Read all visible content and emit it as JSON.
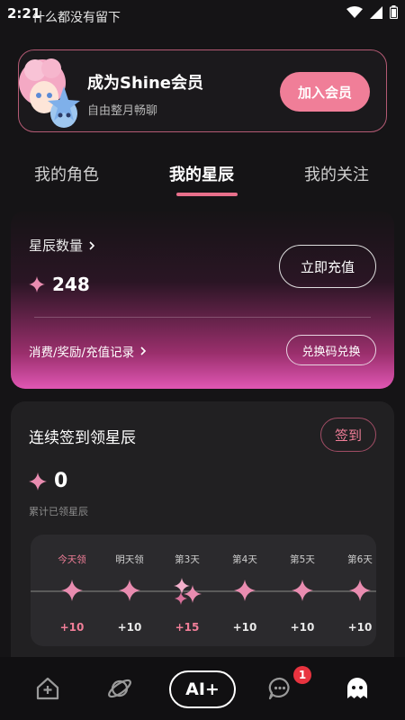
{
  "status_bar": {
    "time": "2:21",
    "toast": "什么都没有留下"
  },
  "vip_banner": {
    "title": "成为Shine会员",
    "subtitle": "自由整月畅聊",
    "join_label": "加入会员"
  },
  "tabs": [
    {
      "label": "我的角色",
      "active": false
    },
    {
      "label": "我的星辰",
      "active": true
    },
    {
      "label": "我的关注",
      "active": false
    }
  ],
  "star_card": {
    "count_label": "星辰数量",
    "count_value": "248",
    "recharge_label": "立即充值",
    "record_label": "消费/奖励/充值记录",
    "redeem_label": "兑换码兑换"
  },
  "checkin": {
    "title": "连续签到领星辰",
    "button_label": "签到",
    "count_value": "0",
    "caption": "累计已领星辰",
    "days": [
      {
        "label": "今天领",
        "reward": "+10",
        "state": "today"
      },
      {
        "label": "明天领",
        "reward": "+10",
        "state": "normal"
      },
      {
        "label": "第3天",
        "reward": "+15",
        "state": "special"
      },
      {
        "label": "第4天",
        "reward": "+10",
        "state": "normal"
      },
      {
        "label": "第5天",
        "reward": "+10",
        "state": "normal"
      },
      {
        "label": "第6天",
        "reward": "+10",
        "state": "normal"
      }
    ]
  },
  "bottom_nav": {
    "ai_label": "AI+",
    "message_badge": "1"
  },
  "colors": {
    "accent": "#f07e98",
    "background": "#151416",
    "card": "#212022",
    "badge": "#e8333f"
  }
}
